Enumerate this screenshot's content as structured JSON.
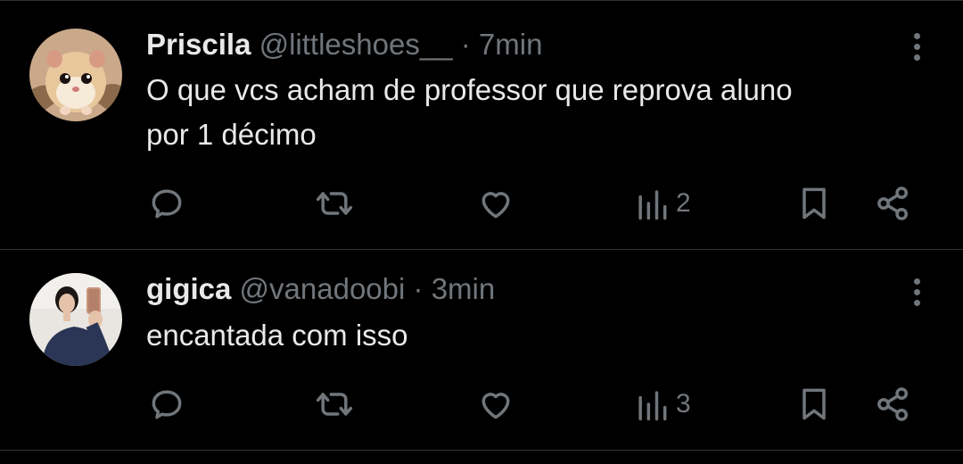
{
  "tweets": [
    {
      "name": "Priscila",
      "handle": "@littleshoes__",
      "separator": "·",
      "time": "7min",
      "text_line1": "O que vcs acham de professor que reprova aluno",
      "text_line2": "por 1 décimo",
      "views": "2",
      "avatar_icon": "hamster-avatar"
    },
    {
      "name": "gigica",
      "handle": "@vanadoobi",
      "separator": "·",
      "time": "3min",
      "text_line1": "encantada com isso",
      "text_line2": "",
      "views": "3",
      "avatar_icon": "woman-selfie-avatar"
    }
  ],
  "icons": [
    "reply-icon",
    "retweet-icon",
    "like-icon",
    "views-icon",
    "bookmark-icon",
    "share-icon",
    "more-icon"
  ],
  "colors": {
    "background": "#000000",
    "text": "#e7e9ea",
    "muted": "#71767b",
    "divider": "#2f3336"
  }
}
